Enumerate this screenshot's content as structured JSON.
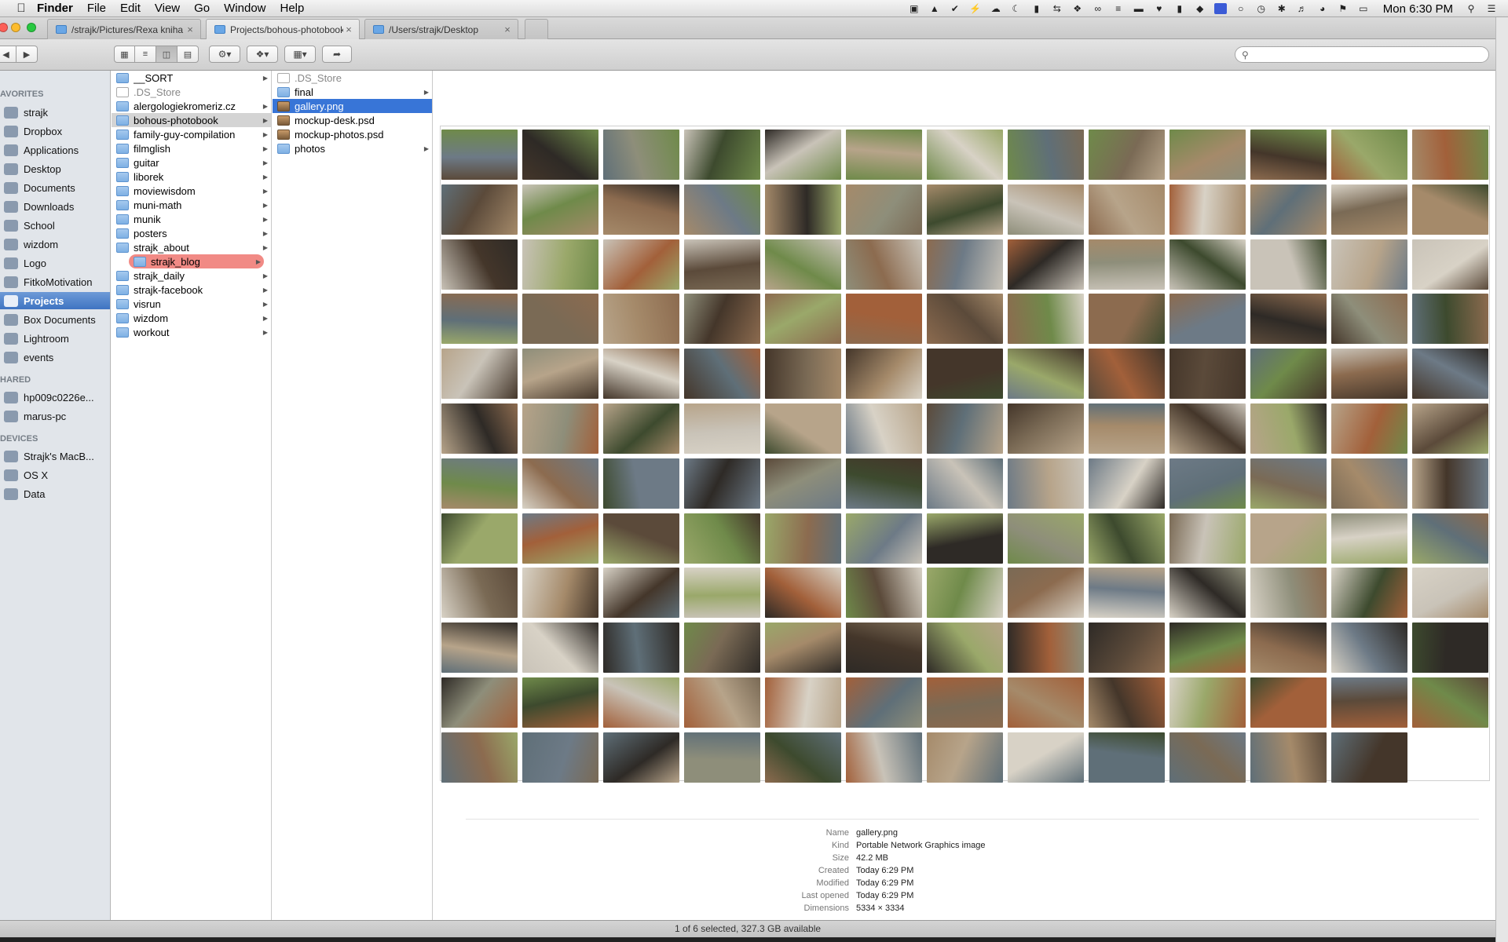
{
  "menubar": {
    "app_name": "Finder",
    "items": [
      "File",
      "Edit",
      "View",
      "Go",
      "Window",
      "Help"
    ],
    "clock": "Mon 6:30 PM"
  },
  "tabs": [
    {
      "label": "/strajk/Pictures/Rexa kniha",
      "active": false
    },
    {
      "label": "Projects/bohous-photobook",
      "active": true
    },
    {
      "label": "/Users/strajk/Desktop",
      "active": false
    }
  ],
  "search": {
    "placeholder": "",
    "value": ""
  },
  "sidebar": {
    "favorites_heading": "AVORITES",
    "favorites": [
      "strajk",
      "Dropbox",
      "Applications",
      "Desktop",
      "Documents",
      "Downloads",
      "School",
      "wizdom",
      "Logo",
      "FitkoMotivation",
      "Projects",
      "Box Documents",
      "Lightroom",
      "events"
    ],
    "selected": "Projects",
    "shared_heading": "HARED",
    "shared": [
      "hp009c0226e...",
      "marus-pc"
    ],
    "devices_heading": "DEVICES",
    "devices": [
      "Strajk's MacB...",
      "OS X",
      "Data"
    ]
  },
  "column1": {
    "items": [
      {
        "name": "__SORT",
        "kind": "folder",
        "has_children": true
      },
      {
        "name": ".DS_Store",
        "kind": "doc",
        "has_children": false
      },
      {
        "name": "alergologiekromeriz.cz",
        "kind": "folder",
        "has_children": true
      },
      {
        "name": "bohous-photobook",
        "kind": "folder",
        "has_children": true,
        "state": "path"
      },
      {
        "name": "family-guy-compilation",
        "kind": "folder",
        "has_children": true
      },
      {
        "name": "filmglish",
        "kind": "folder",
        "has_children": true
      },
      {
        "name": "guitar",
        "kind": "folder",
        "has_children": true
      },
      {
        "name": "liborek",
        "kind": "folder",
        "has_children": true
      },
      {
        "name": "moviewisdom",
        "kind": "folder",
        "has_children": true
      },
      {
        "name": "muni-math",
        "kind": "folder",
        "has_children": true
      },
      {
        "name": "munik",
        "kind": "folder",
        "has_children": true
      },
      {
        "name": "posters",
        "kind": "folder",
        "has_children": true
      },
      {
        "name": "strajk_about",
        "kind": "folder",
        "has_children": true
      },
      {
        "name": "strajk_blog",
        "kind": "folder",
        "has_children": true,
        "state": "tag"
      },
      {
        "name": "strajk_daily",
        "kind": "folder",
        "has_children": true
      },
      {
        "name": "strajk-facebook",
        "kind": "folder",
        "has_children": true
      },
      {
        "name": "visrun",
        "kind": "folder",
        "has_children": true
      },
      {
        "name": "wizdom",
        "kind": "folder",
        "has_children": true
      },
      {
        "name": "workout",
        "kind": "folder",
        "has_children": true
      }
    ]
  },
  "column2": {
    "items": [
      {
        "name": ".DS_Store",
        "kind": "doc",
        "has_children": false
      },
      {
        "name": "final",
        "kind": "folder",
        "has_children": true
      },
      {
        "name": "gallery.png",
        "kind": "img",
        "has_children": false,
        "state": "selected"
      },
      {
        "name": "mockup-desk.psd",
        "kind": "img",
        "has_children": false
      },
      {
        "name": "mockup-photos.psd",
        "kind": "img",
        "has_children": false
      },
      {
        "name": "photos",
        "kind": "folder",
        "has_children": true
      }
    ]
  },
  "preview": {
    "grid_columns": 13,
    "grid_rows": 12,
    "tile_count": 155,
    "palette": [
      "#5b4a3a",
      "#7a6a55",
      "#3d4a2e",
      "#6f8a4a",
      "#a58a6a",
      "#c9c3b8",
      "#8c6b4f",
      "#44362a",
      "#b7a48a",
      "#6d7a86",
      "#9aa86a",
      "#d8d2c6",
      "#2e2a26",
      "#a2603a",
      "#5f6f78",
      "#8e8e7a"
    ],
    "info": [
      {
        "key": "Name",
        "value": "gallery.png"
      },
      {
        "key": "Kind",
        "value": "Portable Network Graphics image"
      },
      {
        "key": "Size",
        "value": "42.2 MB"
      },
      {
        "key": "Created",
        "value": "Today 6:29 PM"
      },
      {
        "key": "Modified",
        "value": "Today 6:29 PM"
      },
      {
        "key": "Last opened",
        "value": "Today 6:29 PM"
      },
      {
        "key": "Dimensions",
        "value": "5334 × 3334"
      }
    ]
  },
  "statusbar": {
    "text": "1 of 6 selected, 327.3 GB available"
  }
}
